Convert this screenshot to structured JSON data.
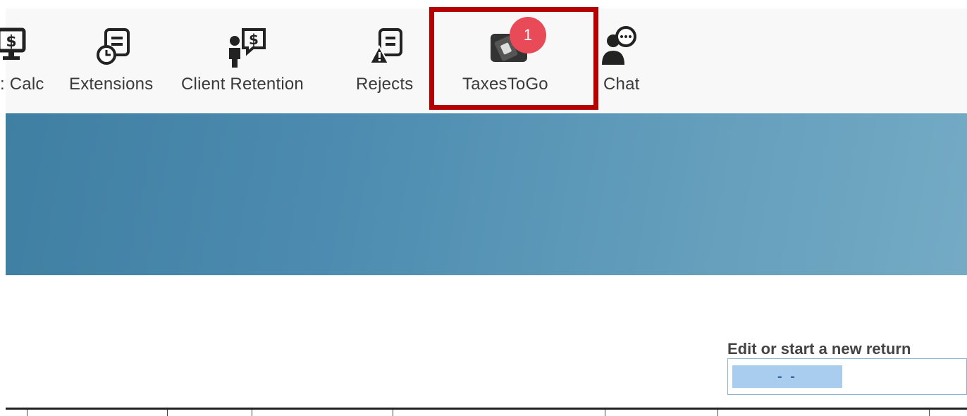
{
  "toolbar": {
    "items": [
      {
        "label": ": Calc",
        "icon": "monitor-dollar-icon"
      },
      {
        "label": "Extensions",
        "icon": "document-clock-icon"
      },
      {
        "label": "Client Retention",
        "icon": "person-dollar-icon"
      },
      {
        "label": "Rejects",
        "icon": "document-warning-icon"
      },
      {
        "label": "TaxesToGo",
        "icon": "phone-app-icon",
        "badge": "1"
      },
      {
        "label": "Chat",
        "icon": "person-speech-icon"
      }
    ],
    "highlight_color": "#b60000",
    "badge_color": "#e84a57"
  },
  "banner": {
    "color_start": "#3f7fa2",
    "color_end": "#74aac4"
  },
  "edit_return": {
    "label": "Edit or start a new return",
    "ssn_value": "- -"
  }
}
